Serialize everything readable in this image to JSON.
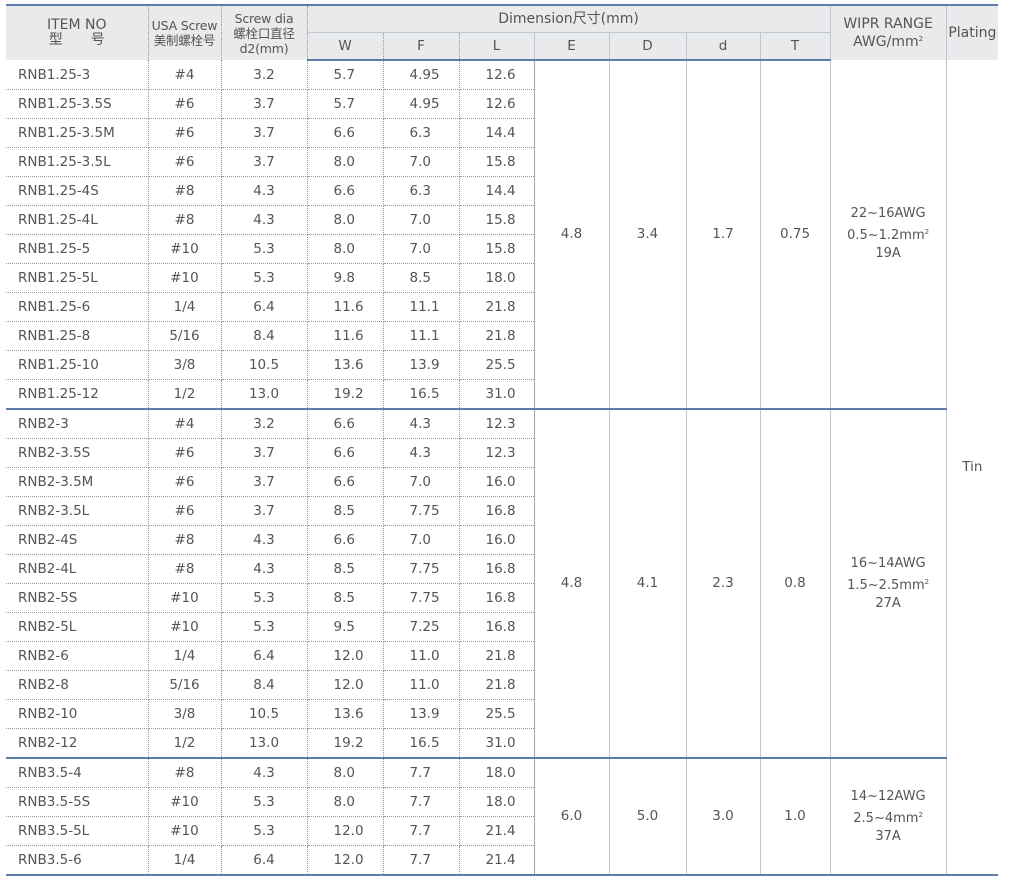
{
  "header": {
    "item_no_en": "ITEM NO",
    "item_no_cn": "型　　号",
    "screw_en": "USA Screw",
    "screw_cn": "美制螺栓号",
    "dia_line1": "Screw dia",
    "dia_line2": "螺栓口直径",
    "dia_line3": "d2(mm)",
    "dimension": "Dimension尺寸(mm)",
    "W": "W",
    "F": "F",
    "L": "L",
    "E": "E",
    "D": "D",
    "d": "d",
    "T": "T",
    "wire_line1": "WIPR RANGE",
    "wire_line2": "AWG/mm",
    "wire_sup": "2",
    "plating": "Plating"
  },
  "plating_value": "Tin",
  "groups": [
    {
      "E": "4.8",
      "D": "3.4",
      "d": "1.7",
      "T": "0.75",
      "wire": [
        "22~16AWG",
        "0.5~1.2mm",
        "19A"
      ],
      "wire_sup": "2",
      "rows": [
        [
          "RNB1.25-3",
          "#4",
          "3.2",
          "5.7",
          "4.95",
          "12.6"
        ],
        [
          "RNB1.25-3.5S",
          "#6",
          "3.7",
          "5.7",
          "4.95",
          "12.6"
        ],
        [
          "RNB1.25-3.5M",
          "#6",
          "3.7",
          "6.6",
          "6.3",
          "14.4"
        ],
        [
          "RNB1.25-3.5L",
          "#6",
          "3.7",
          "8.0",
          "7.0",
          "15.8"
        ],
        [
          "RNB1.25-4S",
          "#8",
          "4.3",
          "6.6",
          "6.3",
          "14.4"
        ],
        [
          "RNB1.25-4L",
          "#8",
          "4.3",
          "8.0",
          "7.0",
          "15.8"
        ],
        [
          "RNB1.25-5",
          "#10",
          "5.3",
          "8.0",
          "7.0",
          "15.8"
        ],
        [
          "RNB1.25-5L",
          "#10",
          "5.3",
          "9.8",
          "8.5",
          "18.0"
        ],
        [
          "RNB1.25-6",
          "1/4",
          "6.4",
          "11.6",
          "11.1",
          "21.8"
        ],
        [
          "RNB1.25-8",
          "5/16",
          "8.4",
          "11.6",
          "11.1",
          "21.8"
        ],
        [
          "RNB1.25-10",
          "3/8",
          "10.5",
          "13.6",
          "13.9",
          "25.5"
        ],
        [
          "RNB1.25-12",
          "1/2",
          "13.0",
          "19.2",
          "16.5",
          "31.0"
        ]
      ]
    },
    {
      "E": "4.8",
      "D": "4.1",
      "d": "2.3",
      "T": "0.8",
      "wire": [
        "16~14AWG",
        "1.5~2.5mm",
        "27A"
      ],
      "wire_sup": "2",
      "rows": [
        [
          "RNB2-3",
          "#4",
          "3.2",
          "6.6",
          "4.3",
          "12.3"
        ],
        [
          "RNB2-3.5S",
          "#6",
          "3.7",
          "6.6",
          "4.3",
          "12.3"
        ],
        [
          "RNB2-3.5M",
          "#6",
          "3.7",
          "6.6",
          "7.0",
          "16.0"
        ],
        [
          "RNB2-3.5L",
          "#6",
          "3.7",
          "8.5",
          "7.75",
          "16.8"
        ],
        [
          "RNB2-4S",
          "#8",
          "4.3",
          "6.6",
          "7.0",
          "16.0"
        ],
        [
          "RNB2-4L",
          "#8",
          "4.3",
          "8.5",
          "7.75",
          "16.8"
        ],
        [
          "RNB2-5S",
          "#10",
          "5.3",
          "8.5",
          "7.75",
          "16.8"
        ],
        [
          "RNB2-5L",
          "#10",
          "5.3",
          "9.5",
          "7.25",
          "16.8"
        ],
        [
          "RNB2-6",
          "1/4",
          "6.4",
          "12.0",
          "11.0",
          "21.8"
        ],
        [
          "RNB2-8",
          "5/16",
          "8.4",
          "12.0",
          "11.0",
          "21.8"
        ],
        [
          "RNB2-10",
          "3/8",
          "10.5",
          "13.6",
          "13.9",
          "25.5"
        ],
        [
          "RNB2-12",
          "1/2",
          "13.0",
          "19.2",
          "16.5",
          "31.0"
        ]
      ]
    },
    {
      "E": "6.0",
      "D": "5.0",
      "d": "3.0",
      "T": "1.0",
      "wire": [
        "14~12AWG",
        "2.5~4mm",
        "37A"
      ],
      "wire_sup": "2",
      "rows": [
        [
          "RNB3.5-4",
          "#8",
          "4.3",
          "8.0",
          "7.7",
          "18.0"
        ],
        [
          "RNB3.5-5S",
          "#10",
          "5.3",
          "8.0",
          "7.7",
          "18.0"
        ],
        [
          "RNB3.5-5L",
          "#10",
          "5.3",
          "12.0",
          "7.7",
          "21.4"
        ],
        [
          "RNB3.5-6",
          "1/4",
          "6.4",
          "12.0",
          "7.7",
          "21.4"
        ]
      ]
    }
  ]
}
